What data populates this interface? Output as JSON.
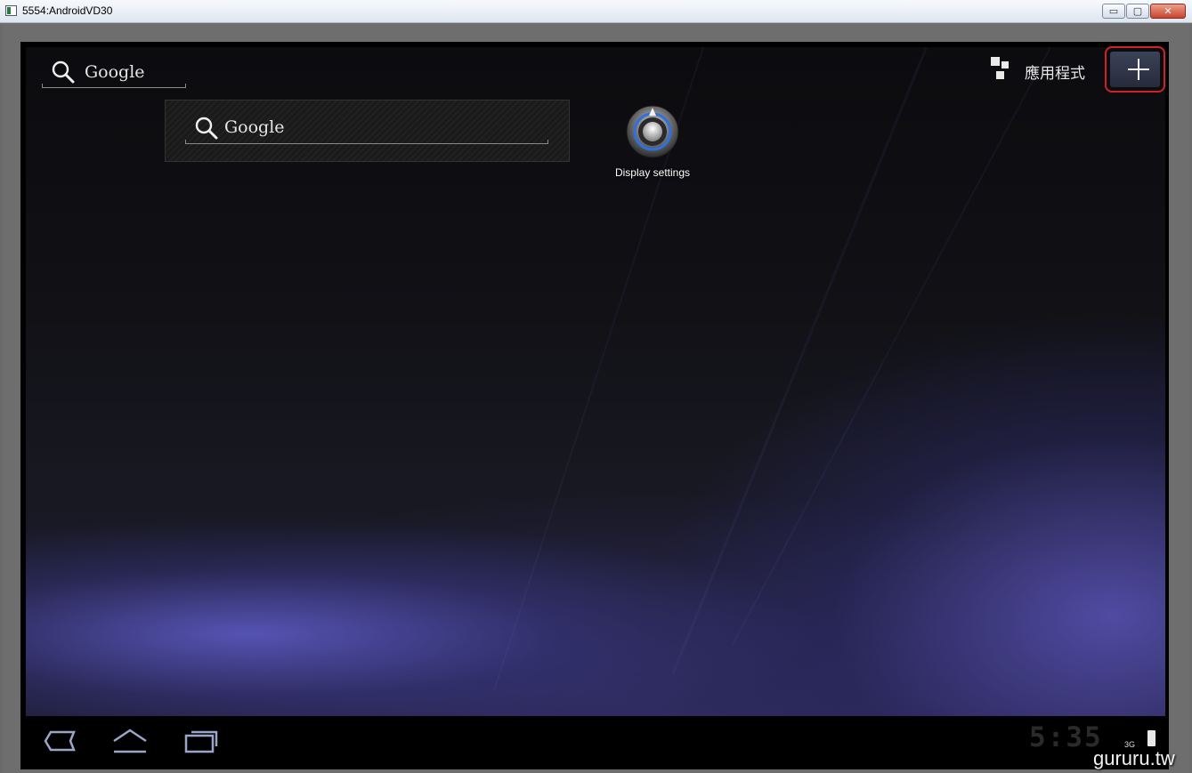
{
  "window": {
    "title": "5554:AndroidVD30",
    "minimize_glyph": "▭",
    "maximize_glyph": "▢",
    "close_glyph": "✕"
  },
  "home": {
    "top_search_label": "Google",
    "widget_search_label": "Google",
    "shortcut_label": "Display settings",
    "apps_label": "應用程式",
    "add_icon": "plus-icon"
  },
  "system_bar": {
    "nav_icons": [
      "back-icon",
      "home-icon",
      "recent-apps-icon"
    ],
    "clock": "5:35",
    "network": "3G"
  },
  "watermark": "gururu.tw",
  "colors": {
    "highlight": "#d0202a",
    "wallpaper_accent": "#5856b9"
  }
}
